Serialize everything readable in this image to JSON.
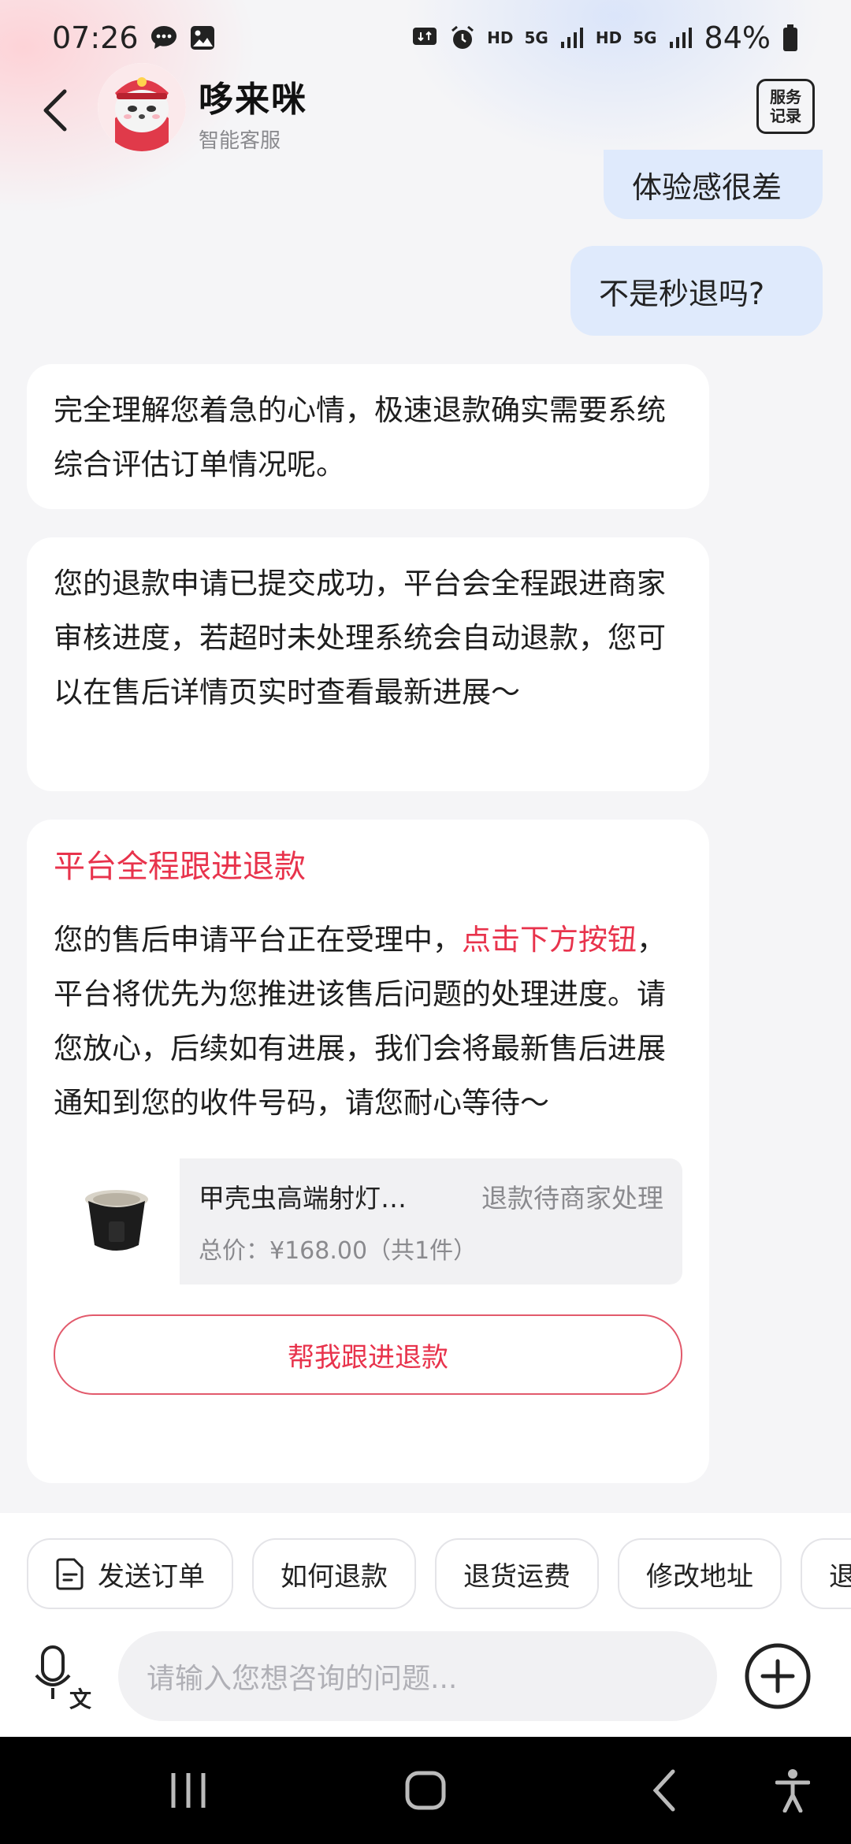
{
  "status_bar": {
    "time": "07:26",
    "net_hd1": "HD",
    "net_5g1": "5G",
    "net_hd2": "HD",
    "net_5g2": "5G",
    "battery": "84%"
  },
  "header": {
    "bot_name": "哆来咪",
    "bot_subtitle": "智能客服",
    "records_label": "服务记录"
  },
  "messages": {
    "user_1": "体验感很差",
    "user_2": "不是秒退吗?",
    "bot_1": "完全理解您着急的心情，极速退款确实需要系统综合评估订单情况呢。",
    "bot_2": "您的退款申请已提交成功，平台会全程跟进商家审核进度，若超时未处理系统会自动退款，您可以在售后详情页实时查看最新进展～",
    "card": {
      "title": "平台全程跟进退款",
      "text_before": "您的售后申请平台正在受理中，",
      "text_highlight": "点击下方按钮",
      "text_after": "，平台将优先为您推进该售后问题的处理进度。请您放心，后续如有进展，我们会将最新售后进展通知到您的收件号码，请您耐心等待～",
      "order": {
        "name": "甲壳虫高端射灯…",
        "status": "退款待商家处理",
        "price": "总价：¥168.00（共1件）"
      },
      "button": "帮我跟进退款"
    }
  },
  "quick_actions": [
    "发送订单",
    "如何退款",
    "退货运费",
    "修改地址",
    "退"
  ],
  "input": {
    "placeholder": "请输入您想咨询的问题..."
  },
  "colors": {
    "accent": "#e8334c",
    "user_bubble": "#dfeafc",
    "background": "#f5f5f7"
  },
  "icons": {
    "back": "chevron-left-icon",
    "records": "service-records-icon",
    "send_order": "document-icon",
    "voice": "voice-translate-icon",
    "plus": "plus-circle-icon",
    "nav_recents": "recents-icon",
    "nav_home": "home-icon",
    "nav_back": "nav-back-icon",
    "nav_accessibility": "accessibility-icon"
  }
}
